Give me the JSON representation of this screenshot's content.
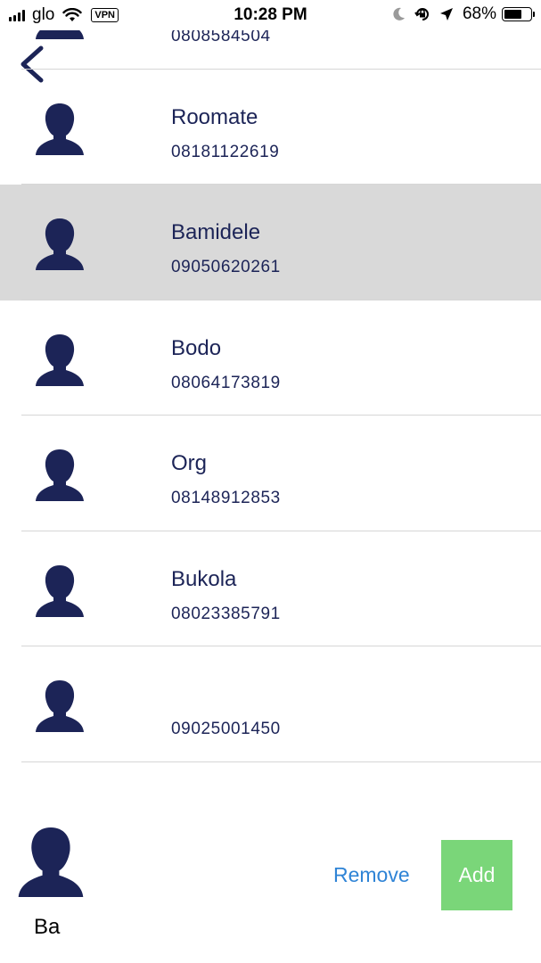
{
  "status_bar": {
    "carrier": "glo",
    "vpn": "VPN",
    "time": "10:28 PM",
    "battery_percent": "68%",
    "battery_level": 0.68,
    "icons": [
      "signal-icon",
      "wifi-icon",
      "moon-icon",
      "orientation-lock-icon",
      "location-arrow-icon",
      "battery-icon"
    ]
  },
  "nav": {
    "back_icon": "chevron-left-icon"
  },
  "contacts": [
    {
      "name": "",
      "phone": "0808584504"
    },
    {
      "name": "Roomate",
      "phone": "08181122619"
    },
    {
      "name": "Bamidele",
      "phone": "09050620261",
      "selected": true
    },
    {
      "name": "Bodo",
      "phone": "08064173819"
    },
    {
      "name": "Org",
      "phone": "08148912853"
    },
    {
      "name": "Bukola",
      "phone": "08023385791"
    },
    {
      "name": "",
      "phone": "09025001450"
    }
  ],
  "selection": {
    "name": "Ba",
    "remove_label": "Remove",
    "add_label": "Add"
  },
  "colors": {
    "primary": "#1c2457",
    "selected_row": "#d9d9d9",
    "remove": "#2f84d6",
    "add_button": "#7ad679"
  }
}
